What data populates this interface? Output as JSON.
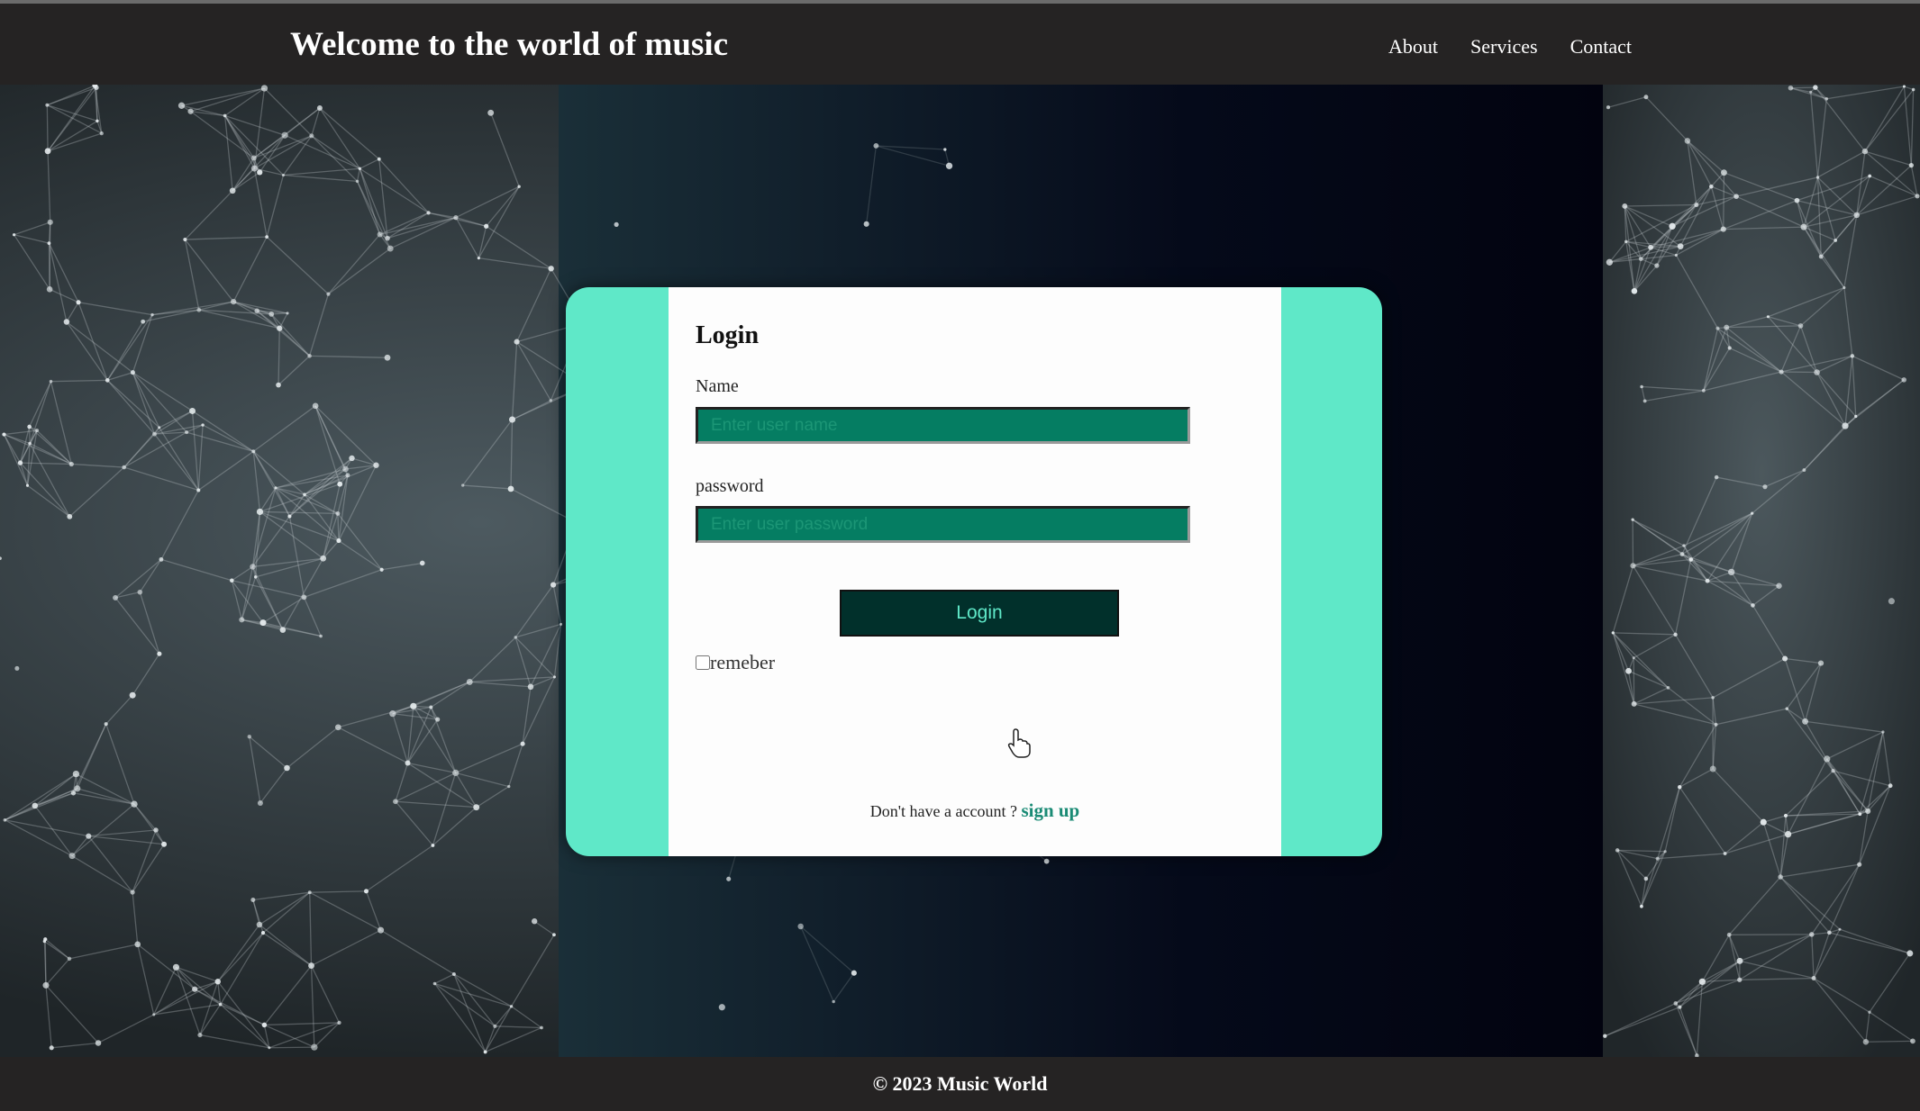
{
  "header": {
    "title": "Welcome to the world of music",
    "nav": [
      "About",
      "Services",
      "Contact"
    ]
  },
  "login": {
    "title": "Login",
    "name_label": "Name",
    "name_placeholder": "Enter user name",
    "password_label": "password",
    "password_placeholder": "Enter user password",
    "button_label": "Login",
    "remember_label": "remeber",
    "signup_prompt": "Don't have a account ? ",
    "signup_link": "sign up"
  },
  "footer": {
    "text": "© 2023 Music World"
  },
  "colors": {
    "accent": "#5fe8c8",
    "input_bg": "#057d62",
    "button_bg": "#01302b",
    "bar_bg": "#252323"
  }
}
